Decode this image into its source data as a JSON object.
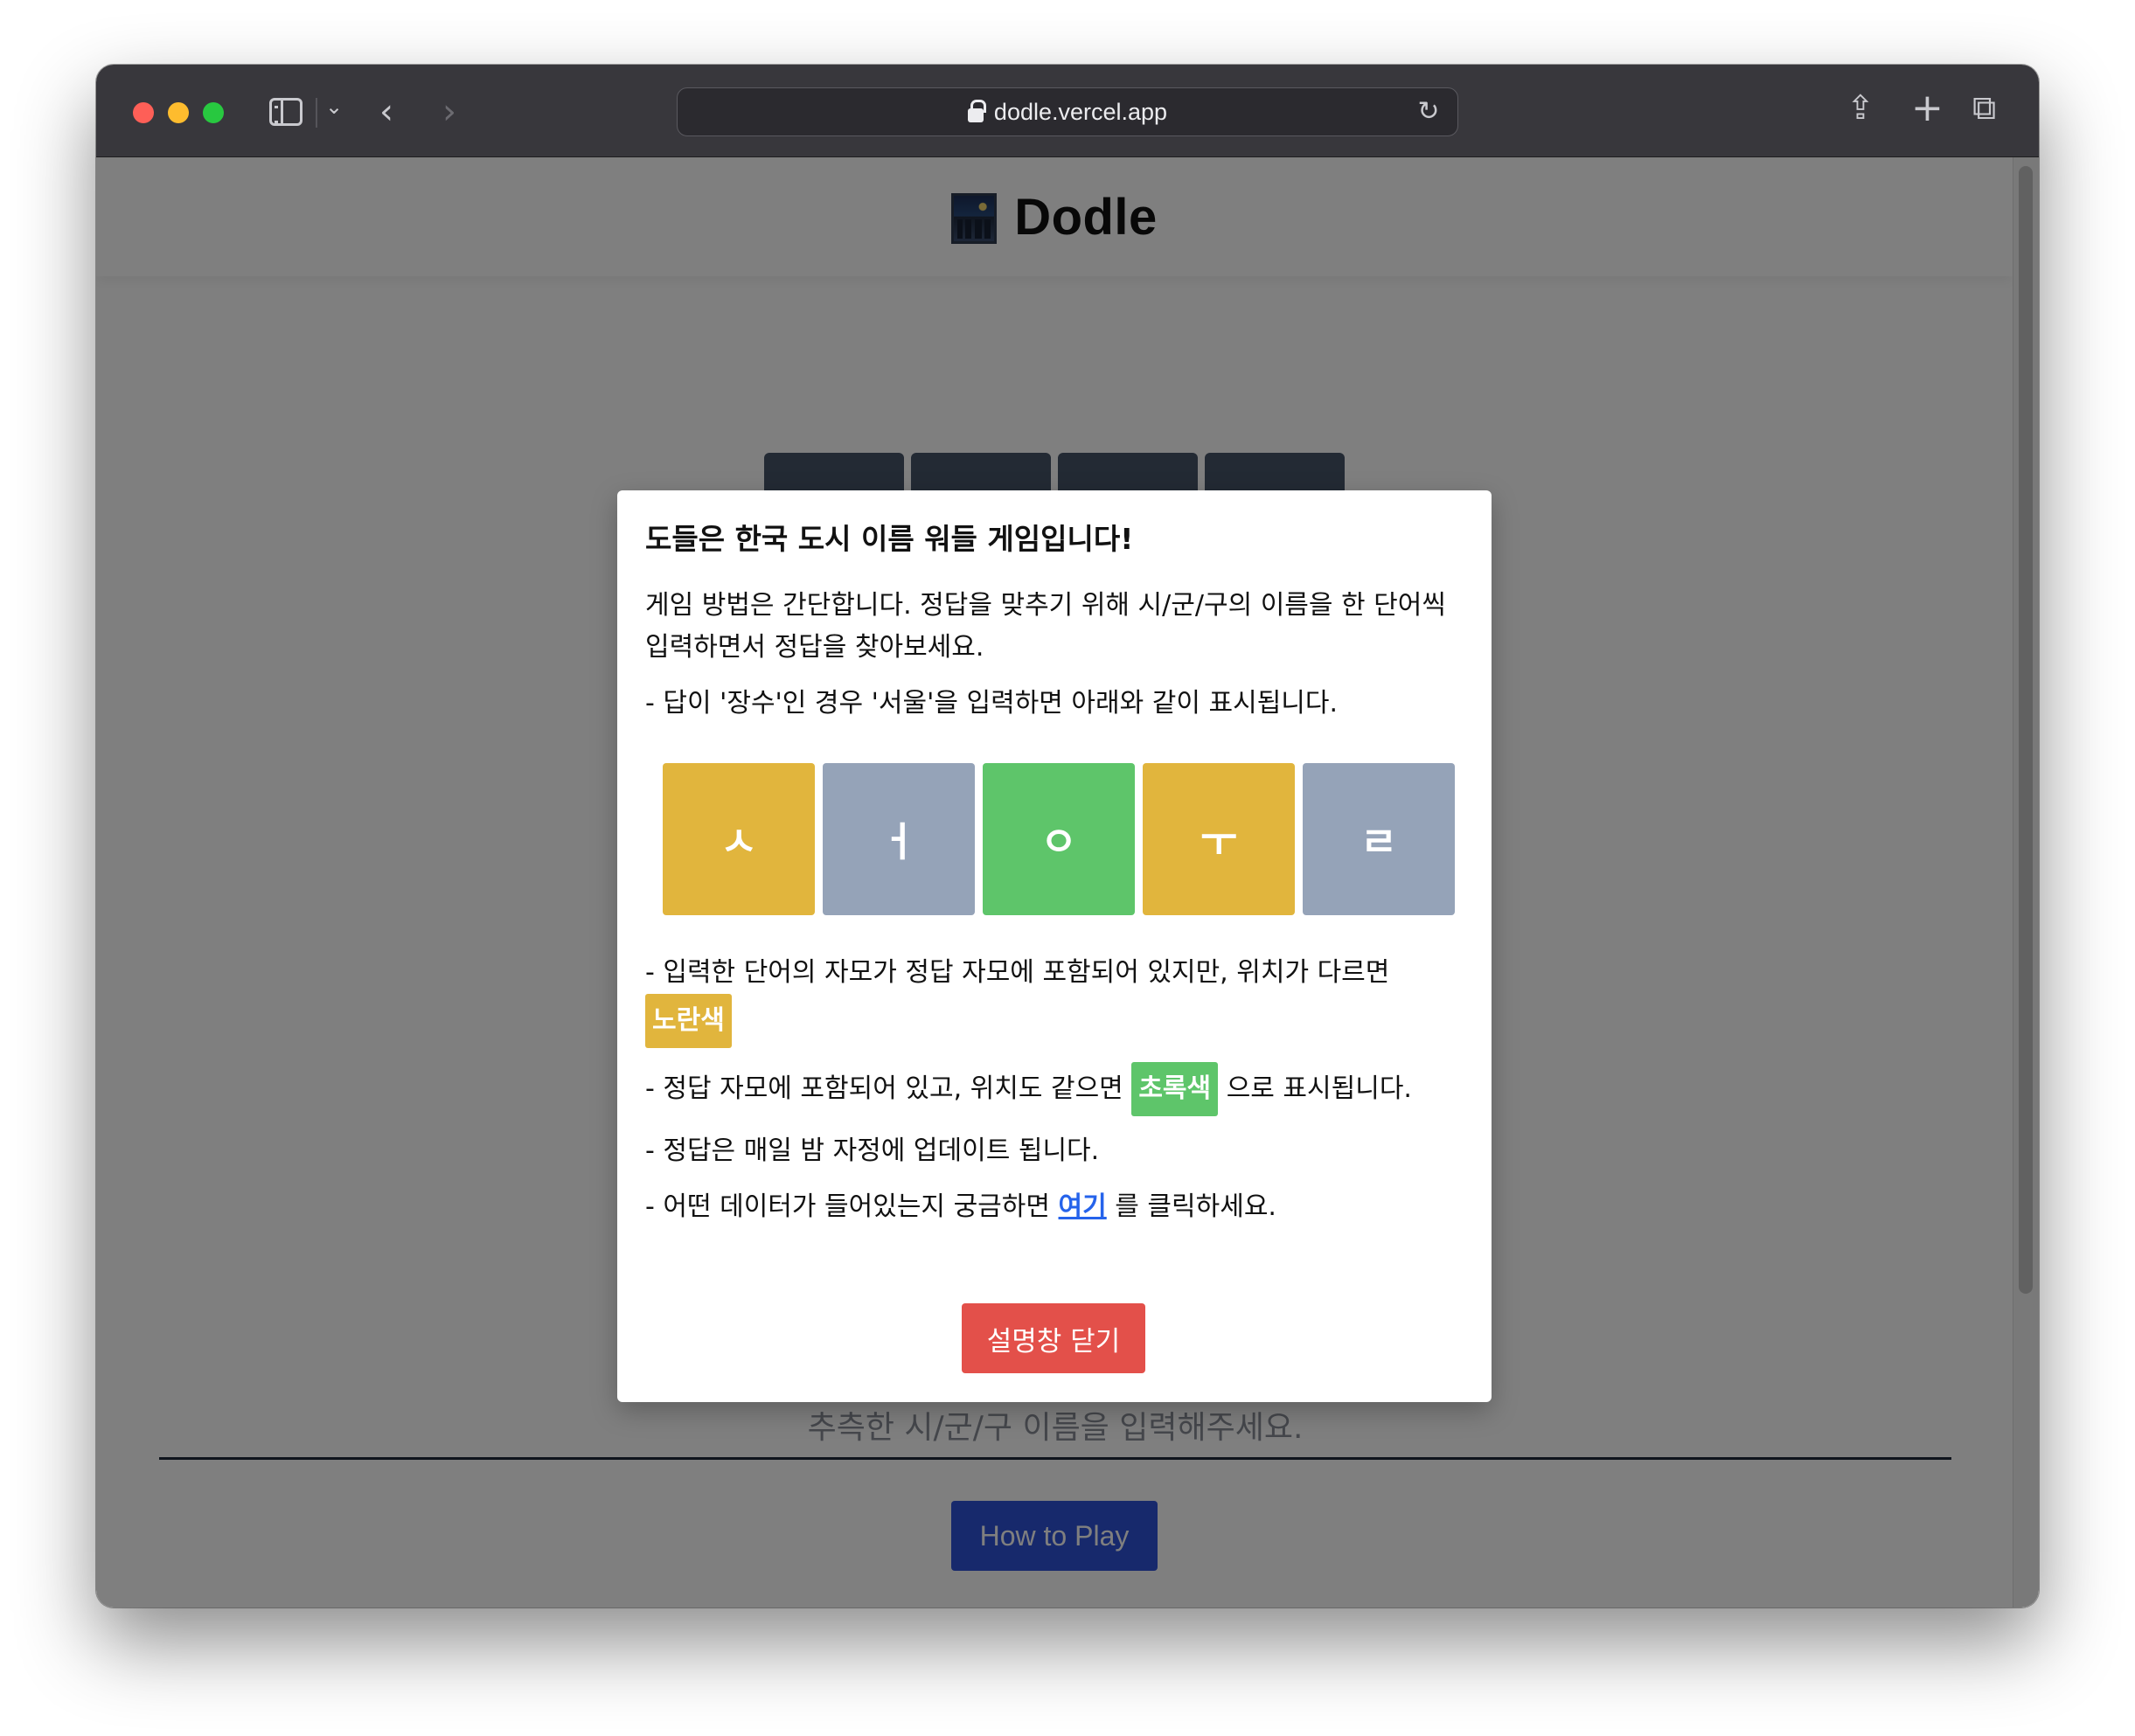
{
  "browser": {
    "url": "dodle.vercel.app"
  },
  "app": {
    "title": "Dodle"
  },
  "board": {
    "tile_count": 4
  },
  "input": {
    "placeholder": "추측한 시/군/구 이름을 입력해주세요."
  },
  "footer": {
    "how_to_play_label": "How to Play"
  },
  "modal": {
    "title": "도들은 한국 도시 이름 워들 게임입니다!",
    "intro": "게임 방법은 간단합니다. 정답을 맞추기 위해 시/군/구의 이름을 한 단어씩 입력하면서 정답을 찾아보세요.",
    "example_caption": "- 답이 '장수'인 경우 '서울'을 입력하면 아래와 같이 표시됩니다.",
    "example_tiles": [
      {
        "char": "ㅅ",
        "state": "present",
        "color": "#e1b53d"
      },
      {
        "char": "ㅓ",
        "state": "absent",
        "color": "#95a3b8"
      },
      {
        "char": "ㅇ",
        "state": "correct",
        "color": "#5ec56a"
      },
      {
        "char": "ㅜ",
        "state": "present",
        "color": "#e1b53d"
      },
      {
        "char": "ㄹ",
        "state": "absent",
        "color": "#95a3b8"
      }
    ],
    "rule_present_prefix": "- 입력한 단어의 자모가 정답 자모에 포함되어 있지만, 위치가 다르면",
    "rule_present_chip": "노란색",
    "rule_correct_prefix": "- 정답 자모에 포함되어 있고, 위치도 같으면",
    "rule_correct_chip": "초록색",
    "rule_correct_suffix": "으로 표시됩니다.",
    "rule_update": "- 정답은 매일 밤 자정에 업데이트 됩니다.",
    "rule_data_prefix": "- 어떤 데이터가 들어있는지 궁금하면",
    "rule_data_link": "여기",
    "rule_data_suffix": "를 클릭하세요.",
    "close_label": "설명창 닫기"
  },
  "colors": {
    "present": "#e1b53d",
    "correct": "#5ec56a",
    "absent": "#95a3b8",
    "close_button": "#e3504a",
    "primary_button": "#2f53d8"
  }
}
